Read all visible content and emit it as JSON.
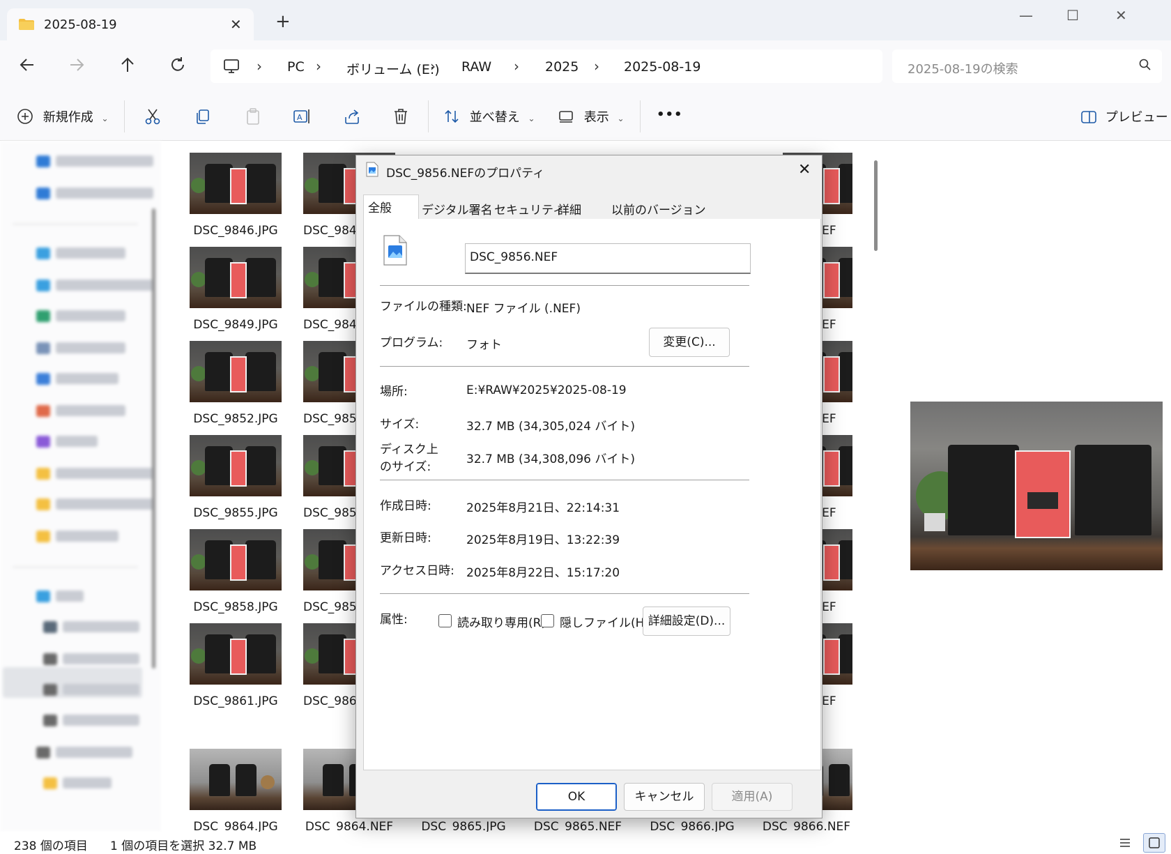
{
  "window": {
    "tab_title": "2025-08-19",
    "new_tab_glyph": "+",
    "close_glyph": "✕",
    "minimize_glyph": "—",
    "maximize_glyph": "☐"
  },
  "address": {
    "breadcrumbs": [
      "PC",
      "ボリューム (E:)",
      "RAW",
      "2025",
      "2025-08-19"
    ],
    "search_placeholder": "2025-08-19の検索"
  },
  "toolbar": {
    "new_label": "新規作成",
    "sort_label": "並べ替え",
    "view_label": "表示",
    "more_label": "•••",
    "preview_label": "プレビュー"
  },
  "files": {
    "rows": [
      [
        "DSC_9846.JPG",
        "DSC_984",
        "",
        "",
        "",
        ".NEF"
      ],
      [
        "DSC_9849.JPG",
        "DSC_984",
        "",
        "",
        "",
        ".NEF"
      ],
      [
        "DSC_9852.JPG",
        "DSC_985",
        "",
        "",
        "",
        ".NEF"
      ],
      [
        "DSC_9855.JPG",
        "DSC_985",
        "",
        "",
        "",
        ".NEF"
      ],
      [
        "DSC_9858.JPG",
        "DSC_985",
        "",
        "",
        "",
        ".NEF"
      ],
      [
        "DSC_9861.JPG",
        "DSC_986",
        "",
        "",
        "",
        ".NEF"
      ],
      [
        "DSC_9864.JPG",
        "DSC_9864.NEF",
        "DSC_9865.JPG",
        "DSC_9865.NEF",
        "DSC_9866.JPG",
        "DSC_9866.NEF"
      ]
    ]
  },
  "status": {
    "item_count": "238 個の項目",
    "selection": "1 個の項目を選択  32.7 MB"
  },
  "dialog": {
    "title": "DSC_9856.NEFのプロパティ",
    "tabs": [
      "全般",
      "デジタル署名",
      "セキュリティ",
      "詳細",
      "以前のバージョン"
    ],
    "active_tab": "全般",
    "filename": "DSC_9856.NEF",
    "type_label": "ファイルの種類:",
    "type_value": "NEF ファイル (.NEF)",
    "program_label": "プログラム:",
    "program_value": "フォト",
    "change_button": "変更(C)...",
    "location_label": "場所:",
    "location_value": "E:¥RAW¥2025¥2025-08-19",
    "size_label": "サイズ:",
    "size_value": "32.7 MB (34,305,024 バイト)",
    "disk_size_label_1": "ディスク上",
    "disk_size_label_2": "のサイズ:",
    "disk_size_value": "32.7 MB (34,308,096 バイト)",
    "created_label": "作成日時:",
    "created_value": "2025年8月21日、22:14:31",
    "modified_label": "更新日時:",
    "modified_value": "2025年8月19日、13:22:39",
    "accessed_label": "アクセス日時:",
    "accessed_value": "2025年8月22日、15:17:20",
    "attributes_label": "属性:",
    "readonly_label": "読み取り専用(R)",
    "readonly_checked": false,
    "hidden_label": "隠しファイル(H)",
    "hidden_checked": false,
    "advanced_button": "詳細設定(D)...",
    "ok_button": "OK",
    "cancel_button": "キャンセル",
    "apply_button": "適用(A)"
  },
  "colors": {
    "accent": "#1b5fc7",
    "folder": "#f4c042",
    "package_red": "#e85b5b"
  }
}
